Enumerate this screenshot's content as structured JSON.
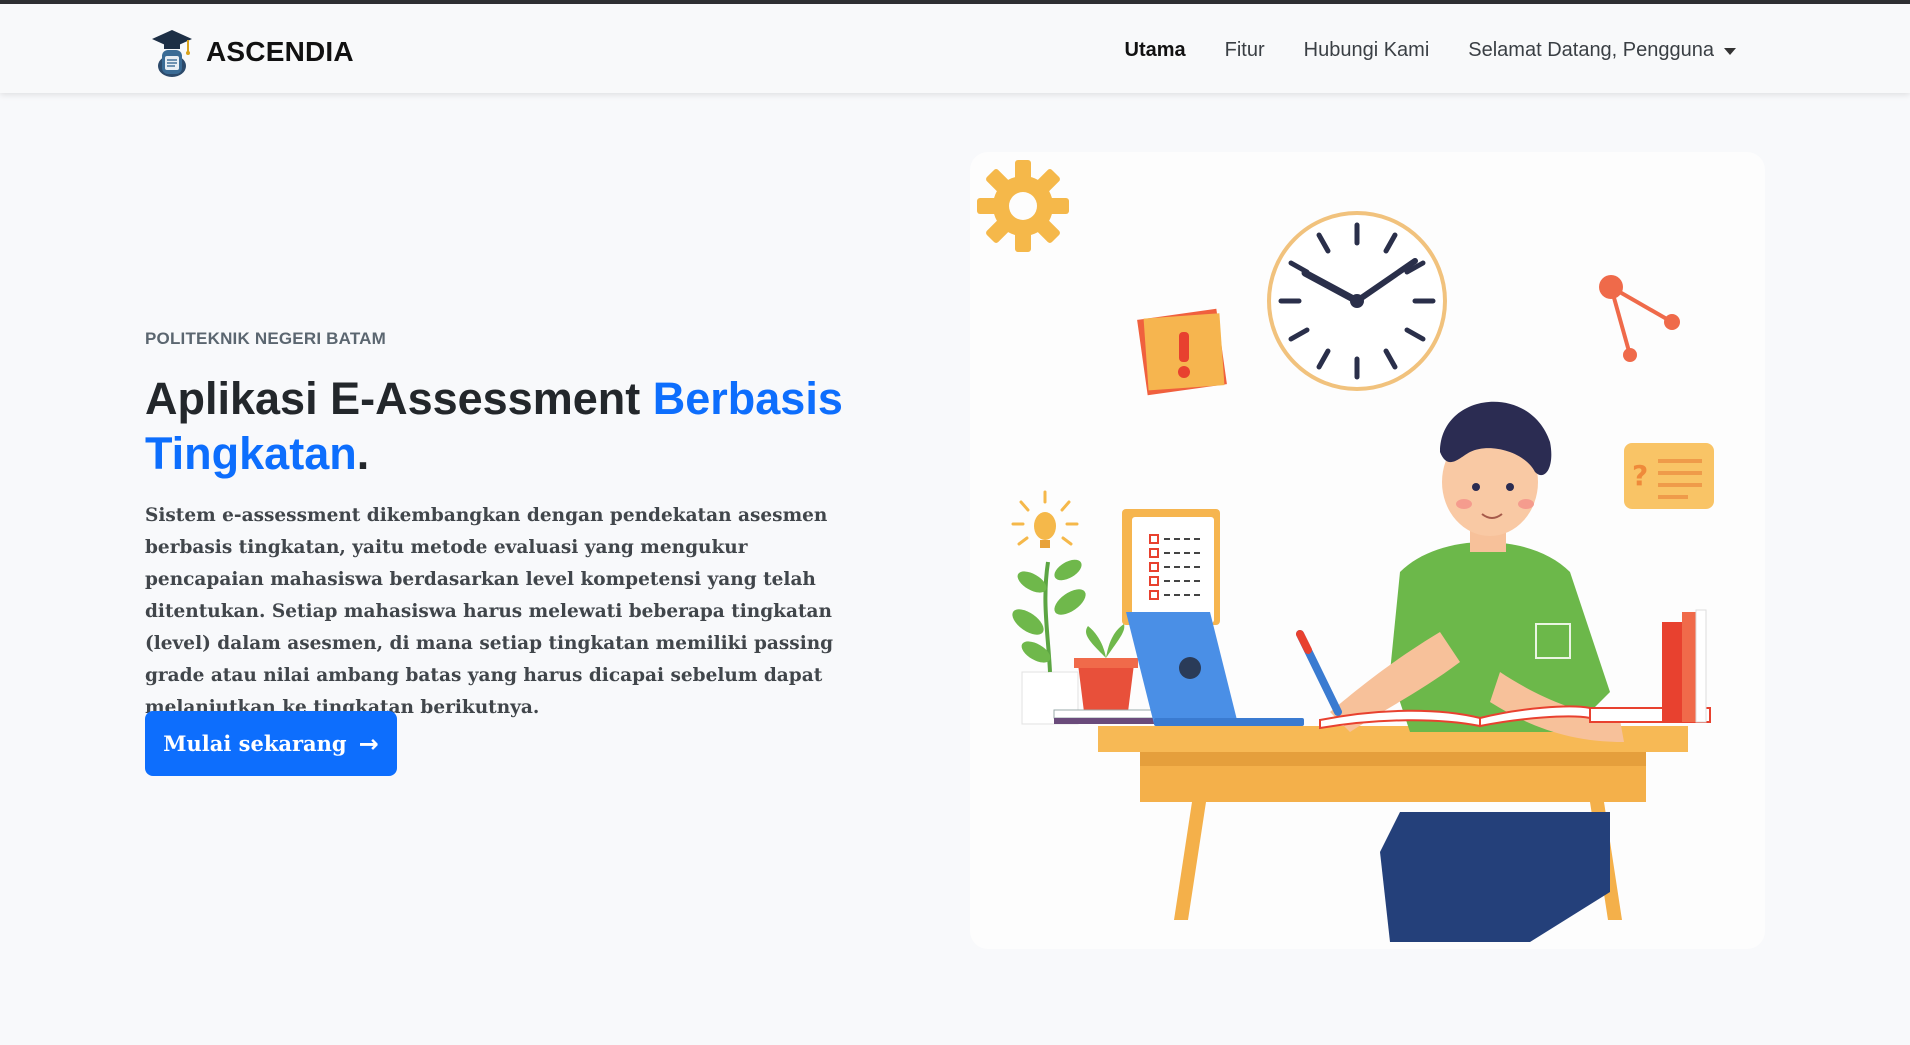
{
  "navbar": {
    "brand": "ASCENDIA",
    "links": [
      {
        "label": "Utama",
        "active": true
      },
      {
        "label": "Fitur",
        "active": false
      },
      {
        "label": "Hubungi Kami",
        "active": false
      }
    ],
    "user_menu": "Selamat Datang, Pengguna"
  },
  "hero": {
    "subtitle": "POLITEKNIK NEGERI BATAM",
    "title_part1": "Aplikasi E-Assessment ",
    "title_accent": "Berbasis Tingkatan",
    "title_end": ".",
    "description": "Sistem e-assessment dikembangkan dengan pendekatan asesmen berbasis tingkatan, yaitu metode evaluasi yang mengukur pencapaian mahasiswa berdasarkan level kompetensi yang telah ditentukan. Setiap mahasiswa harus melewati beberapa tingkatan (level) dalam asesmen, di mana setiap tingkatan memiliki passing grade atau nilai ambang batas yang harus dicapai sebelum dapat melanjutkan ke tingkatan berikutnya.",
    "cta_label": "Mulai sekarang",
    "illustration_icon": "student-studying-illustration"
  },
  "colors": {
    "accent": "#0d6efd",
    "page_bg": "#f8f9fb",
    "navbar_bg": "#f8f9fa"
  }
}
